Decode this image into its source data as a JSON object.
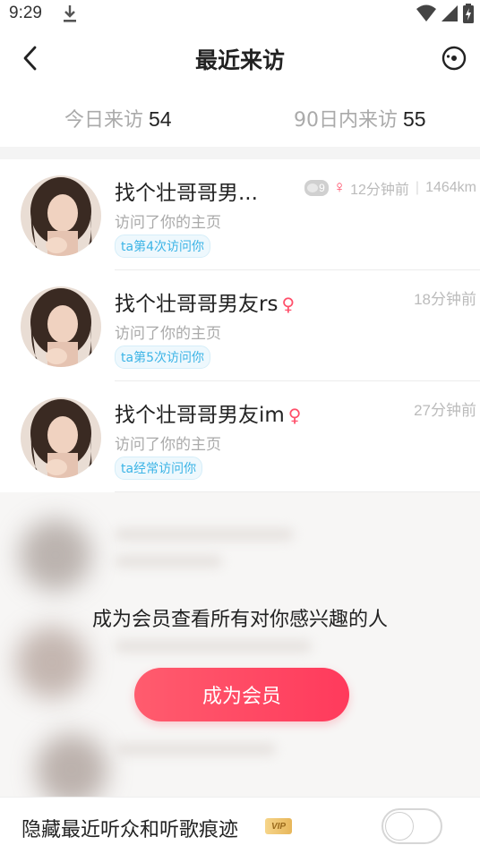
{
  "status_bar": {
    "time": "9:29"
  },
  "header": {
    "title": "最近来访"
  },
  "tabs": {
    "today_label": "今日来访",
    "today_count": "54",
    "ninety_label": "90日内来访",
    "ninety_count": "55"
  },
  "visitors": [
    {
      "name": "找个壮哥哥男...",
      "gender": "♀",
      "badge_count": "9",
      "time": "12分钟前",
      "distance": "1464km",
      "subtitle": "访问了你的主页",
      "tag": "ta第4次访问你"
    },
    {
      "name": "找个壮哥哥男友rs",
      "gender": "♀",
      "time": "18分钟前",
      "subtitle": "访问了你的主页",
      "tag": "ta第5次访问你"
    },
    {
      "name": "找个壮哥哥男友im",
      "gender": "♀",
      "time": "27分钟前",
      "subtitle": "访问了你的主页",
      "tag": "ta经常访问你"
    }
  ],
  "locked": {
    "message": "成为会员查看所有对你感兴趣的人",
    "button_label": "成为会员"
  },
  "bottom": {
    "hide_label": "隐藏最近听众和听歌痕迹",
    "vip_badge": "VIP",
    "toggle_on": false
  },
  "colors": {
    "accent": "#ff3a5c",
    "gender": "#ff4f6a",
    "tag_text": "#3cb4e6"
  }
}
